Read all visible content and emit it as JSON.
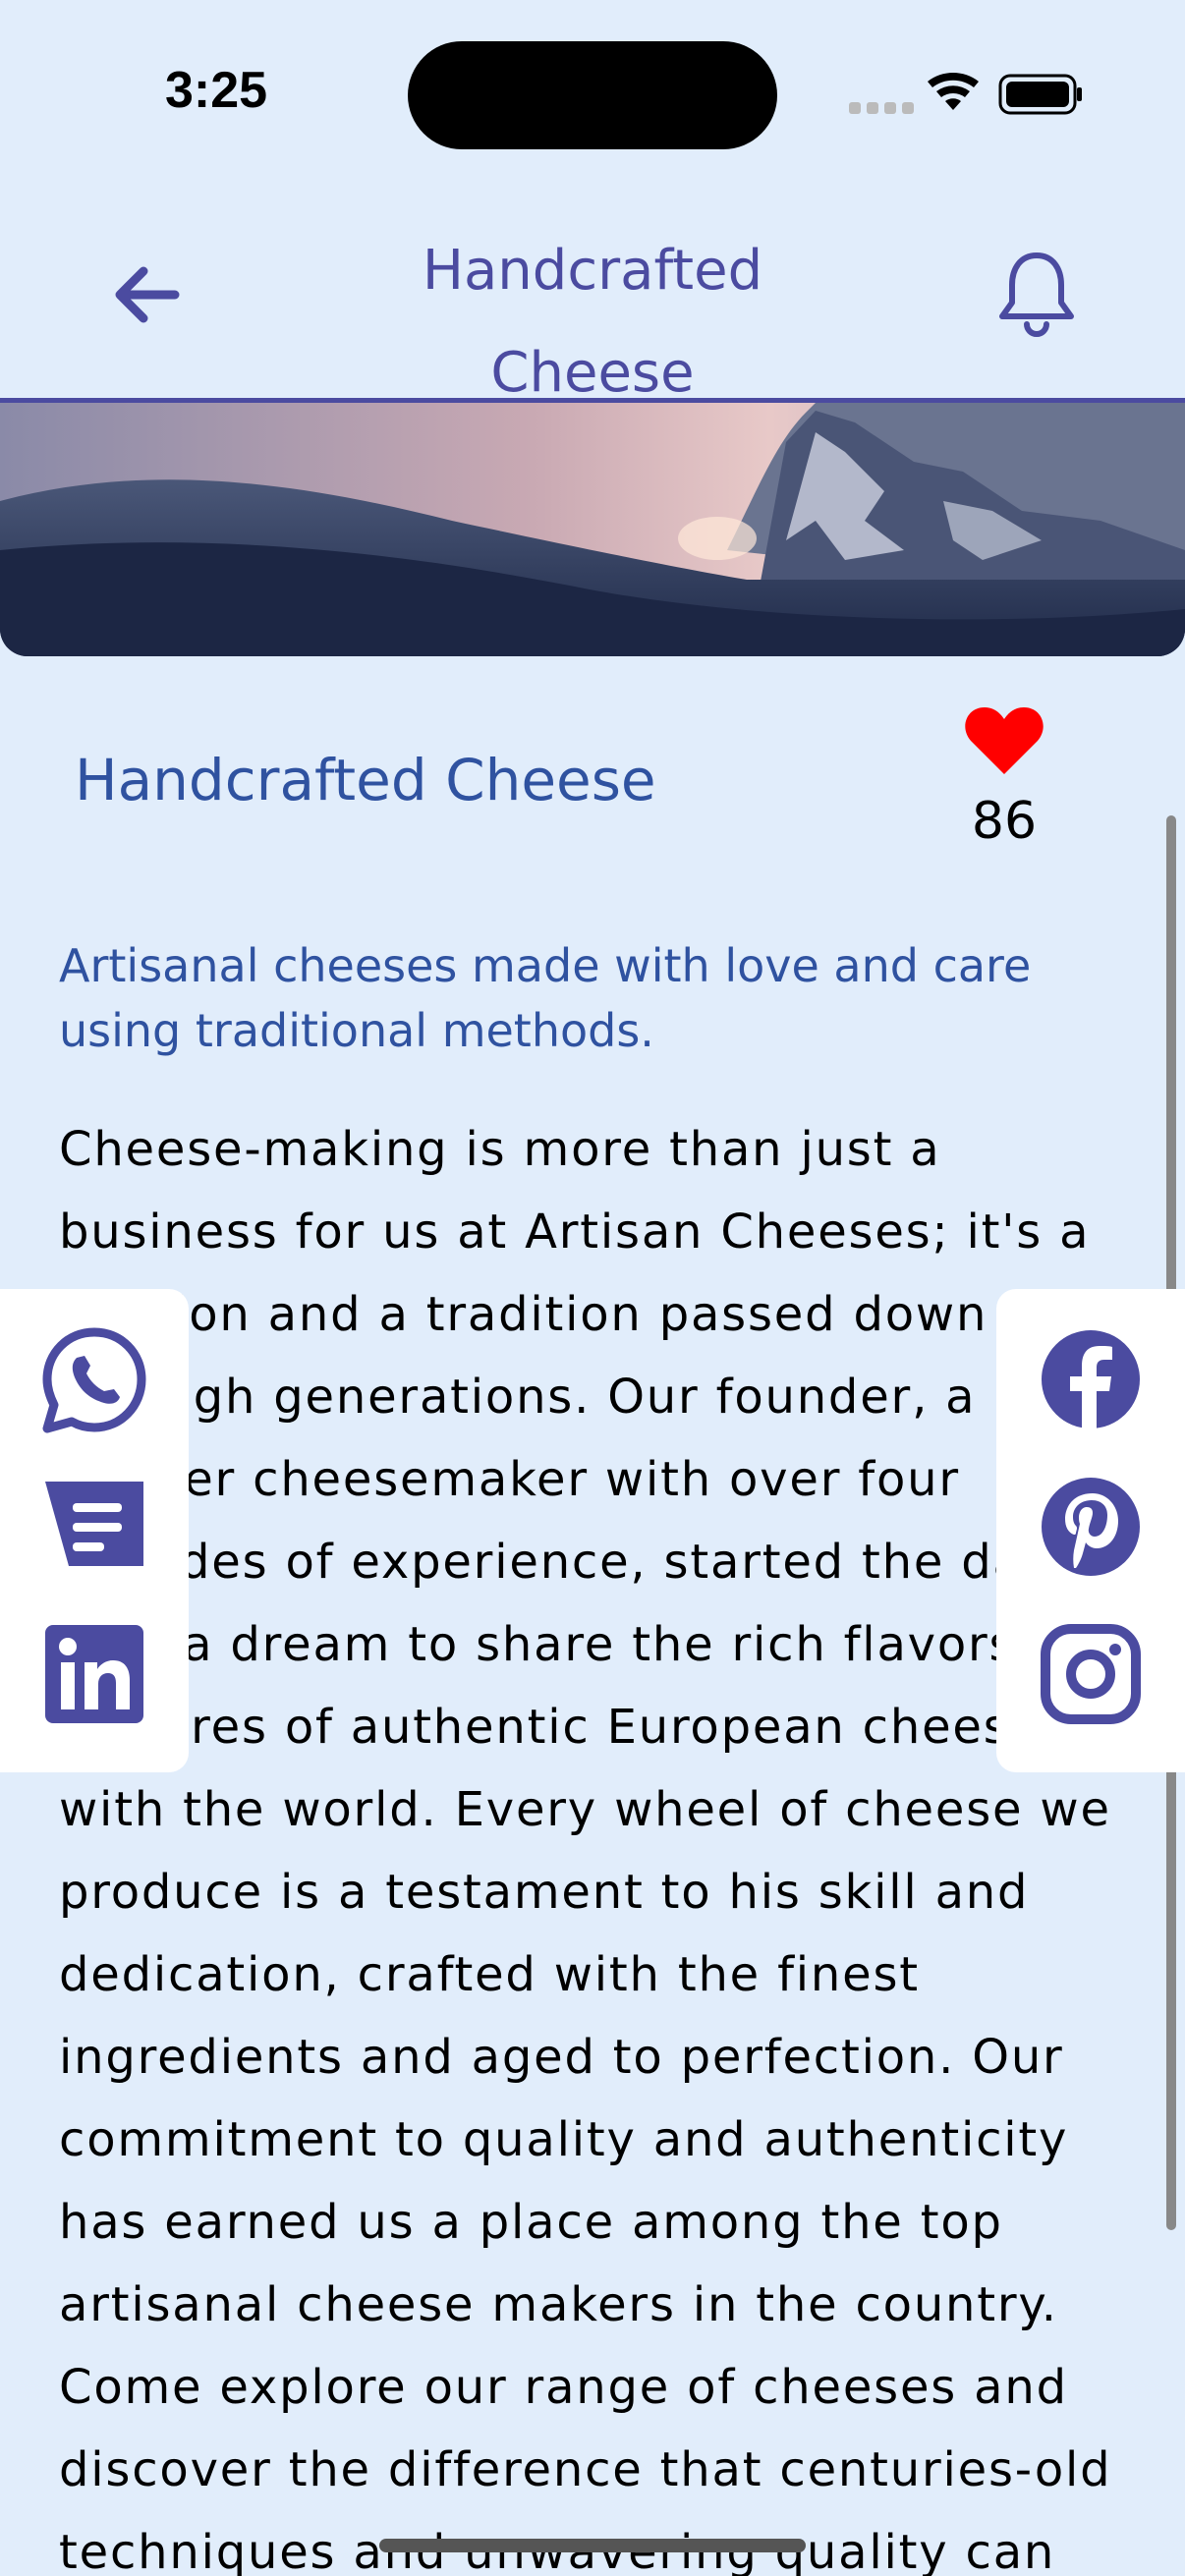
{
  "status_bar": {
    "time": "3:25",
    "icons": [
      "cellular-icon",
      "wifi-icon",
      "battery-icon"
    ]
  },
  "header": {
    "title_line1": "Handcrafted",
    "title_line2": "Cheese",
    "back_icon": "arrow-left-icon",
    "bell_icon": "bell-icon",
    "accent_color": "#4b4ba0"
  },
  "product": {
    "title": "Handcrafted Cheese",
    "likes": "86",
    "like_color": "#ff0000",
    "subtitle": "Artisanal cheeses made with love and care using traditional methods.",
    "description": "Cheese-making is more than just a business for us at Artisan Cheeses; it's a passion and a tradition passed down through generations. Our founder, a master cheesemaker with over four decades of experience, started the dairy with a dream to share the rich flavors and textures of authentic European cheeses with the world. Every wheel of cheese we produce is a testament to his skill and dedication, crafted with the finest ingredients and aged to perfection. Our commitment to quality and authenticity has earned us a place among the top artisanal cheese makers in the country. Come explore our range of cheeses and discover the difference that centuries-old techniques and unwavering quality can"
  },
  "share_left": [
    "whatsapp-icon",
    "message-icon",
    "linkedin-icon"
  ],
  "share_right": [
    "facebook-icon",
    "pinterest-icon",
    "instagram-icon"
  ],
  "colors": {
    "background": "#e1edfb",
    "title_blue": "#2f52a0",
    "icon_purple": "#4b4ba0"
  }
}
